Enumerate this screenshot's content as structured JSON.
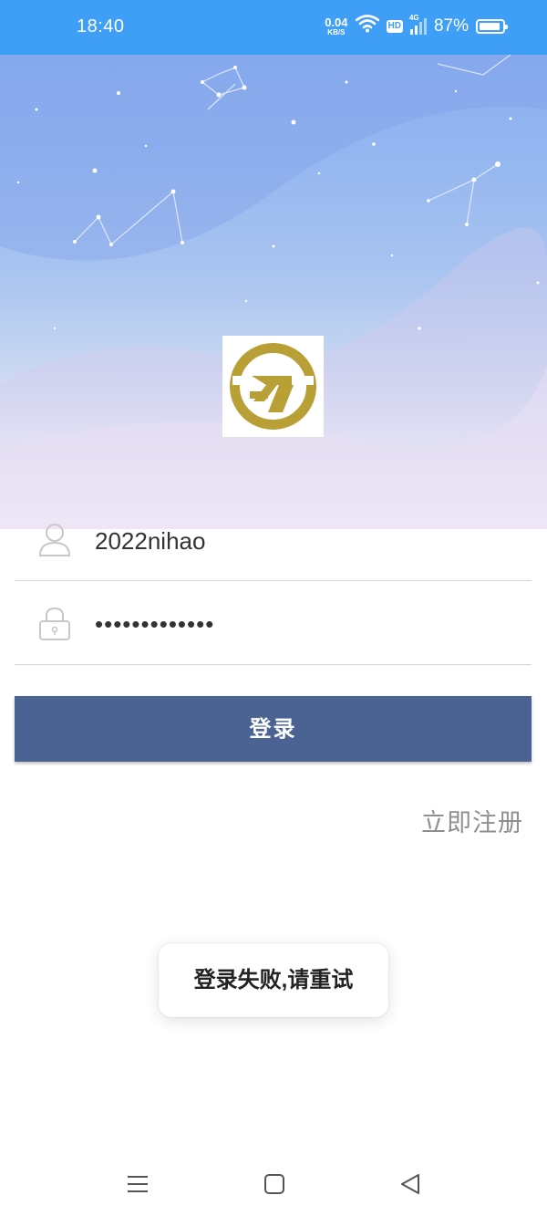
{
  "status_bar": {
    "time": "18:40",
    "net_speed_value": "0.04",
    "net_speed_unit": "KB/S",
    "hd_label": "HD",
    "signal_label": "4G",
    "battery_percent": "87%",
    "battery_level": 0.87,
    "icons": [
      "wifi-icon",
      "hd-icon",
      "signal-icon",
      "battery-icon"
    ]
  },
  "logo": {
    "icon": "company-logo",
    "color": "#b8a037"
  },
  "form": {
    "username": {
      "icon": "user-icon",
      "value": "2022nihao"
    },
    "password": {
      "icon": "lock-icon",
      "value": "•••••••••••••"
    },
    "login_button": "登录",
    "register_link": "立即注册"
  },
  "toast": {
    "message": "登录失败,请重试"
  },
  "nav_bar": {
    "icons": [
      "menu-icon",
      "home-icon",
      "back-icon"
    ]
  },
  "colors": {
    "status_bar": "#3f9ef5",
    "button": "#4a6392",
    "register_text": "#8f8f8f"
  }
}
